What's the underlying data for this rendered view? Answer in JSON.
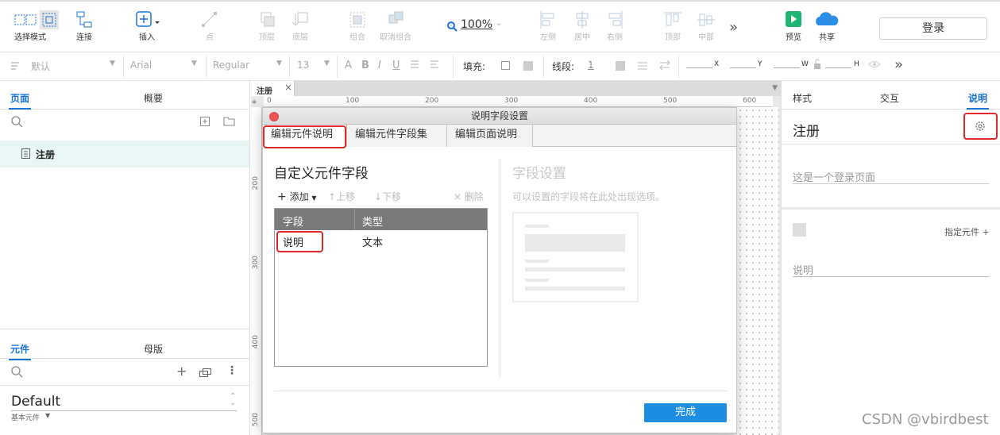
{
  "toolbar": {
    "select_mode": "选择模式",
    "connect": "连接",
    "insert": "插入",
    "point": "点",
    "top_layer": "顶层",
    "bottom_layer": "底层",
    "group": "组合",
    "ungroup": "取消组合",
    "zoom": "100%",
    "align_left": "左侧",
    "align_center": "居中",
    "align_right": "右侧",
    "align_top": "顶部",
    "align_middle": "中部",
    "more": "»",
    "preview": "预览",
    "share": "共享",
    "login": "登录"
  },
  "format_bar": {
    "style": "默认",
    "font": "Arial",
    "weight": "Regular",
    "size": "13",
    "fill_label": "填充:",
    "stroke_label": "线段:",
    "stroke_value": "1",
    "x_label": "X",
    "y_label": "Y",
    "w_label": "W",
    "h_label": "H",
    "more": "»"
  },
  "left_panel": {
    "tabs": [
      "页面",
      "概要"
    ],
    "page_item": "注册",
    "bottom_tabs": [
      "元件",
      "母版"
    ],
    "library": "Default",
    "library_sub": "基本元件"
  },
  "canvas": {
    "tab_label": "注册",
    "ruler_h": [
      "0",
      "100",
      "200",
      "300",
      "400",
      "500",
      "600"
    ],
    "ruler_v": [
      "200",
      "300",
      "400",
      "500"
    ]
  },
  "dialog": {
    "title": "说明字段设置",
    "tabs": [
      "编辑元件说明",
      "编辑元件字段集",
      "编辑页面说明"
    ],
    "section_title": "自定义元件字段",
    "add": "添加",
    "move_up": "上移",
    "move_down": "下移",
    "delete": "删除",
    "columns": [
      "字段",
      "类型"
    ],
    "rows": [
      {
        "field": "说明",
        "type": "文本"
      }
    ],
    "settings_title": "字段设置",
    "settings_hint": "可以设置的字段将在此处出现选项。",
    "done": "完成"
  },
  "right_panel": {
    "tabs": [
      "样式",
      "交互",
      "说明"
    ],
    "page_name": "注册",
    "description": "这是一个登录页面",
    "assign": "指定元件 +",
    "note_label": "说明"
  },
  "watermark": "CSDN @vbirdbest",
  "colors": {
    "accent": "#1a73d9",
    "highlight": "#e0292a",
    "primary_button": "#1f8ee0"
  }
}
